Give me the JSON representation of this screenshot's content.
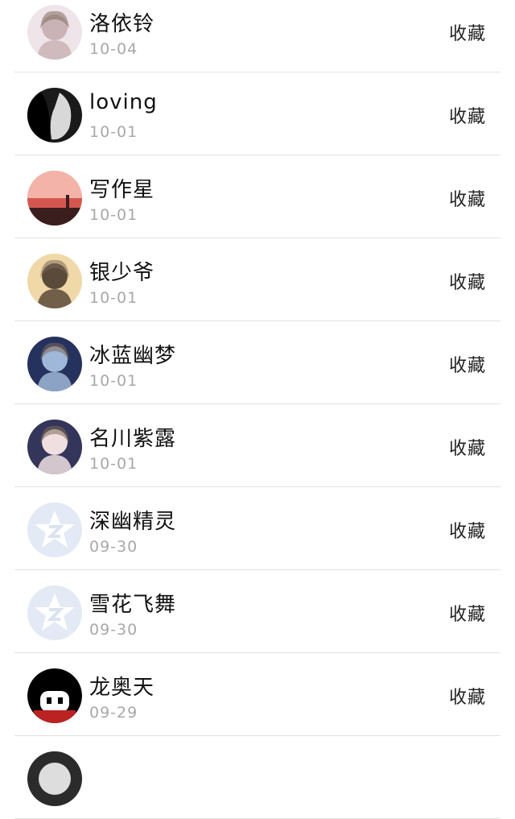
{
  "contacts": [
    {
      "name": "洛依铃",
      "date": "10-04",
      "action": "收藏",
      "avatar": {
        "icon": "anime-girl-avatar",
        "bg": "#efe4ea",
        "fg": "#c9b3b6"
      }
    },
    {
      "name": "loving",
      "date": "10-01",
      "action": "收藏",
      "avatar": {
        "icon": "grayscale-portrait-avatar",
        "bg": "#1a1a1a",
        "fg": "#d8d8d8"
      }
    },
    {
      "name": "写作星",
      "date": "10-01",
      "action": "收藏",
      "avatar": {
        "icon": "sunset-silhouette-avatar",
        "bg": "#e98a7e",
        "fg": "#3a1d1d"
      }
    },
    {
      "name": "银少爷",
      "date": "10-01",
      "action": "收藏",
      "avatar": {
        "icon": "anime-boy-avatar",
        "bg": "#f1d8a8",
        "fg": "#5a4a3a"
      }
    },
    {
      "name": "冰蓝幽梦",
      "date": "10-01",
      "action": "收藏",
      "avatar": {
        "icon": "dark-anime-avatar",
        "bg": "#26325e",
        "fg": "#9fb7d8"
      }
    },
    {
      "name": "名川紫露",
      "date": "10-01",
      "action": "收藏",
      "avatar": {
        "icon": "anime-girl-blue-avatar",
        "bg": "#33355a",
        "fg": "#f0dfe0"
      }
    },
    {
      "name": "深幽精灵",
      "date": "09-30",
      "action": "收藏",
      "avatar": {
        "icon": "default-star-avatar",
        "bg": "#e3eaf5",
        "fg": "#ffffff"
      }
    },
    {
      "name": "雪花飞舞",
      "date": "09-30",
      "action": "收藏",
      "avatar": {
        "icon": "default-star-avatar",
        "bg": "#e3eaf5",
        "fg": "#ffffff"
      }
    },
    {
      "name": "龙奥天",
      "date": "09-29",
      "action": "收藏",
      "avatar": {
        "icon": "cartoon-boy-avatar",
        "bg": "#ffffff",
        "fg": "#000000"
      }
    },
    {
      "name": "",
      "date": "",
      "action": "",
      "avatar": {
        "icon": "partial-avatar",
        "bg": "#2b2b2b",
        "fg": "#dddddd"
      }
    }
  ]
}
